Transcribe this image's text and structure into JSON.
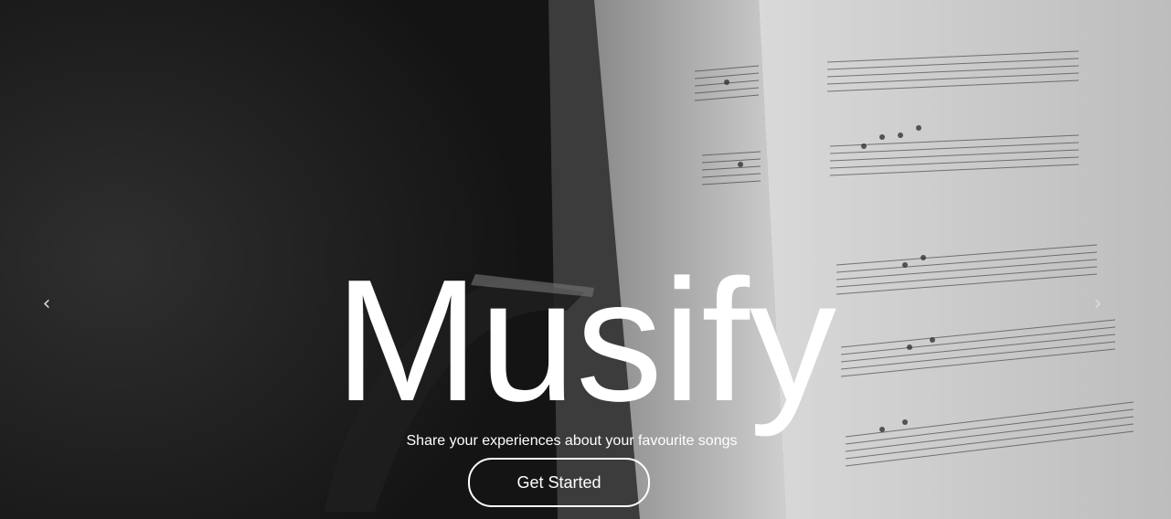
{
  "hero": {
    "title": "Musify",
    "subtitle": "Share your experiences about your favourite songs",
    "cta_label": "Get Started",
    "prev_icon": "chevron-left-icon",
    "next_icon": "chevron-right-icon",
    "prev_glyph": "‹",
    "next_glyph": "›"
  },
  "colors": {
    "text": "#ffffff",
    "background_dark": "#1a1a1a",
    "sheet_light": "#d6d6d6"
  }
}
